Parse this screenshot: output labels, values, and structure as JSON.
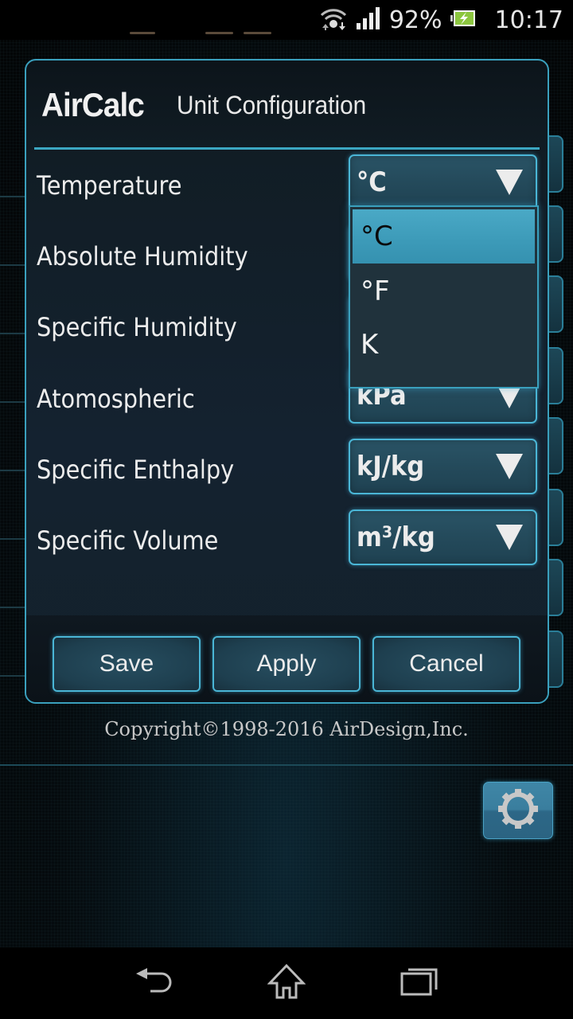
{
  "status_bar": {
    "icons": [
      "wifi-data-icon",
      "signal-icon",
      "battery-charging-icon"
    ],
    "battery_percent": "92%",
    "time": "10:17"
  },
  "dialog": {
    "app_name": "AirCalc",
    "title": "Unit Configuration",
    "rows": [
      {
        "label": "Temperature",
        "value": "°C"
      },
      {
        "label": "Absolute Humidity",
        "value": ""
      },
      {
        "label": "Specific Humidity",
        "value": ""
      },
      {
        "label": "Atomospheric",
        "value": "kPa"
      },
      {
        "label": "Specific Enthalpy",
        "value": "kJ/kg"
      },
      {
        "label": "Specific Volume",
        "value": "m³/kg"
      }
    ],
    "buttons": {
      "save": "Save",
      "apply": "Apply",
      "cancel": "Cancel"
    }
  },
  "dropdown": {
    "for": "Temperature",
    "options": [
      "°C",
      "°F",
      "K"
    ],
    "selected": "°C"
  },
  "background": {
    "copyright": "Copyright©1998-2016 AirDesign,Inc.",
    "settings_icon": "gear-icon"
  },
  "nav_bar": {
    "icons": [
      "back-icon",
      "home-icon",
      "recent-apps-icon"
    ]
  },
  "colors": {
    "accent": "#3aa0bd",
    "selected_option": "#3c9ab8",
    "dialog_bg": "#142230"
  }
}
